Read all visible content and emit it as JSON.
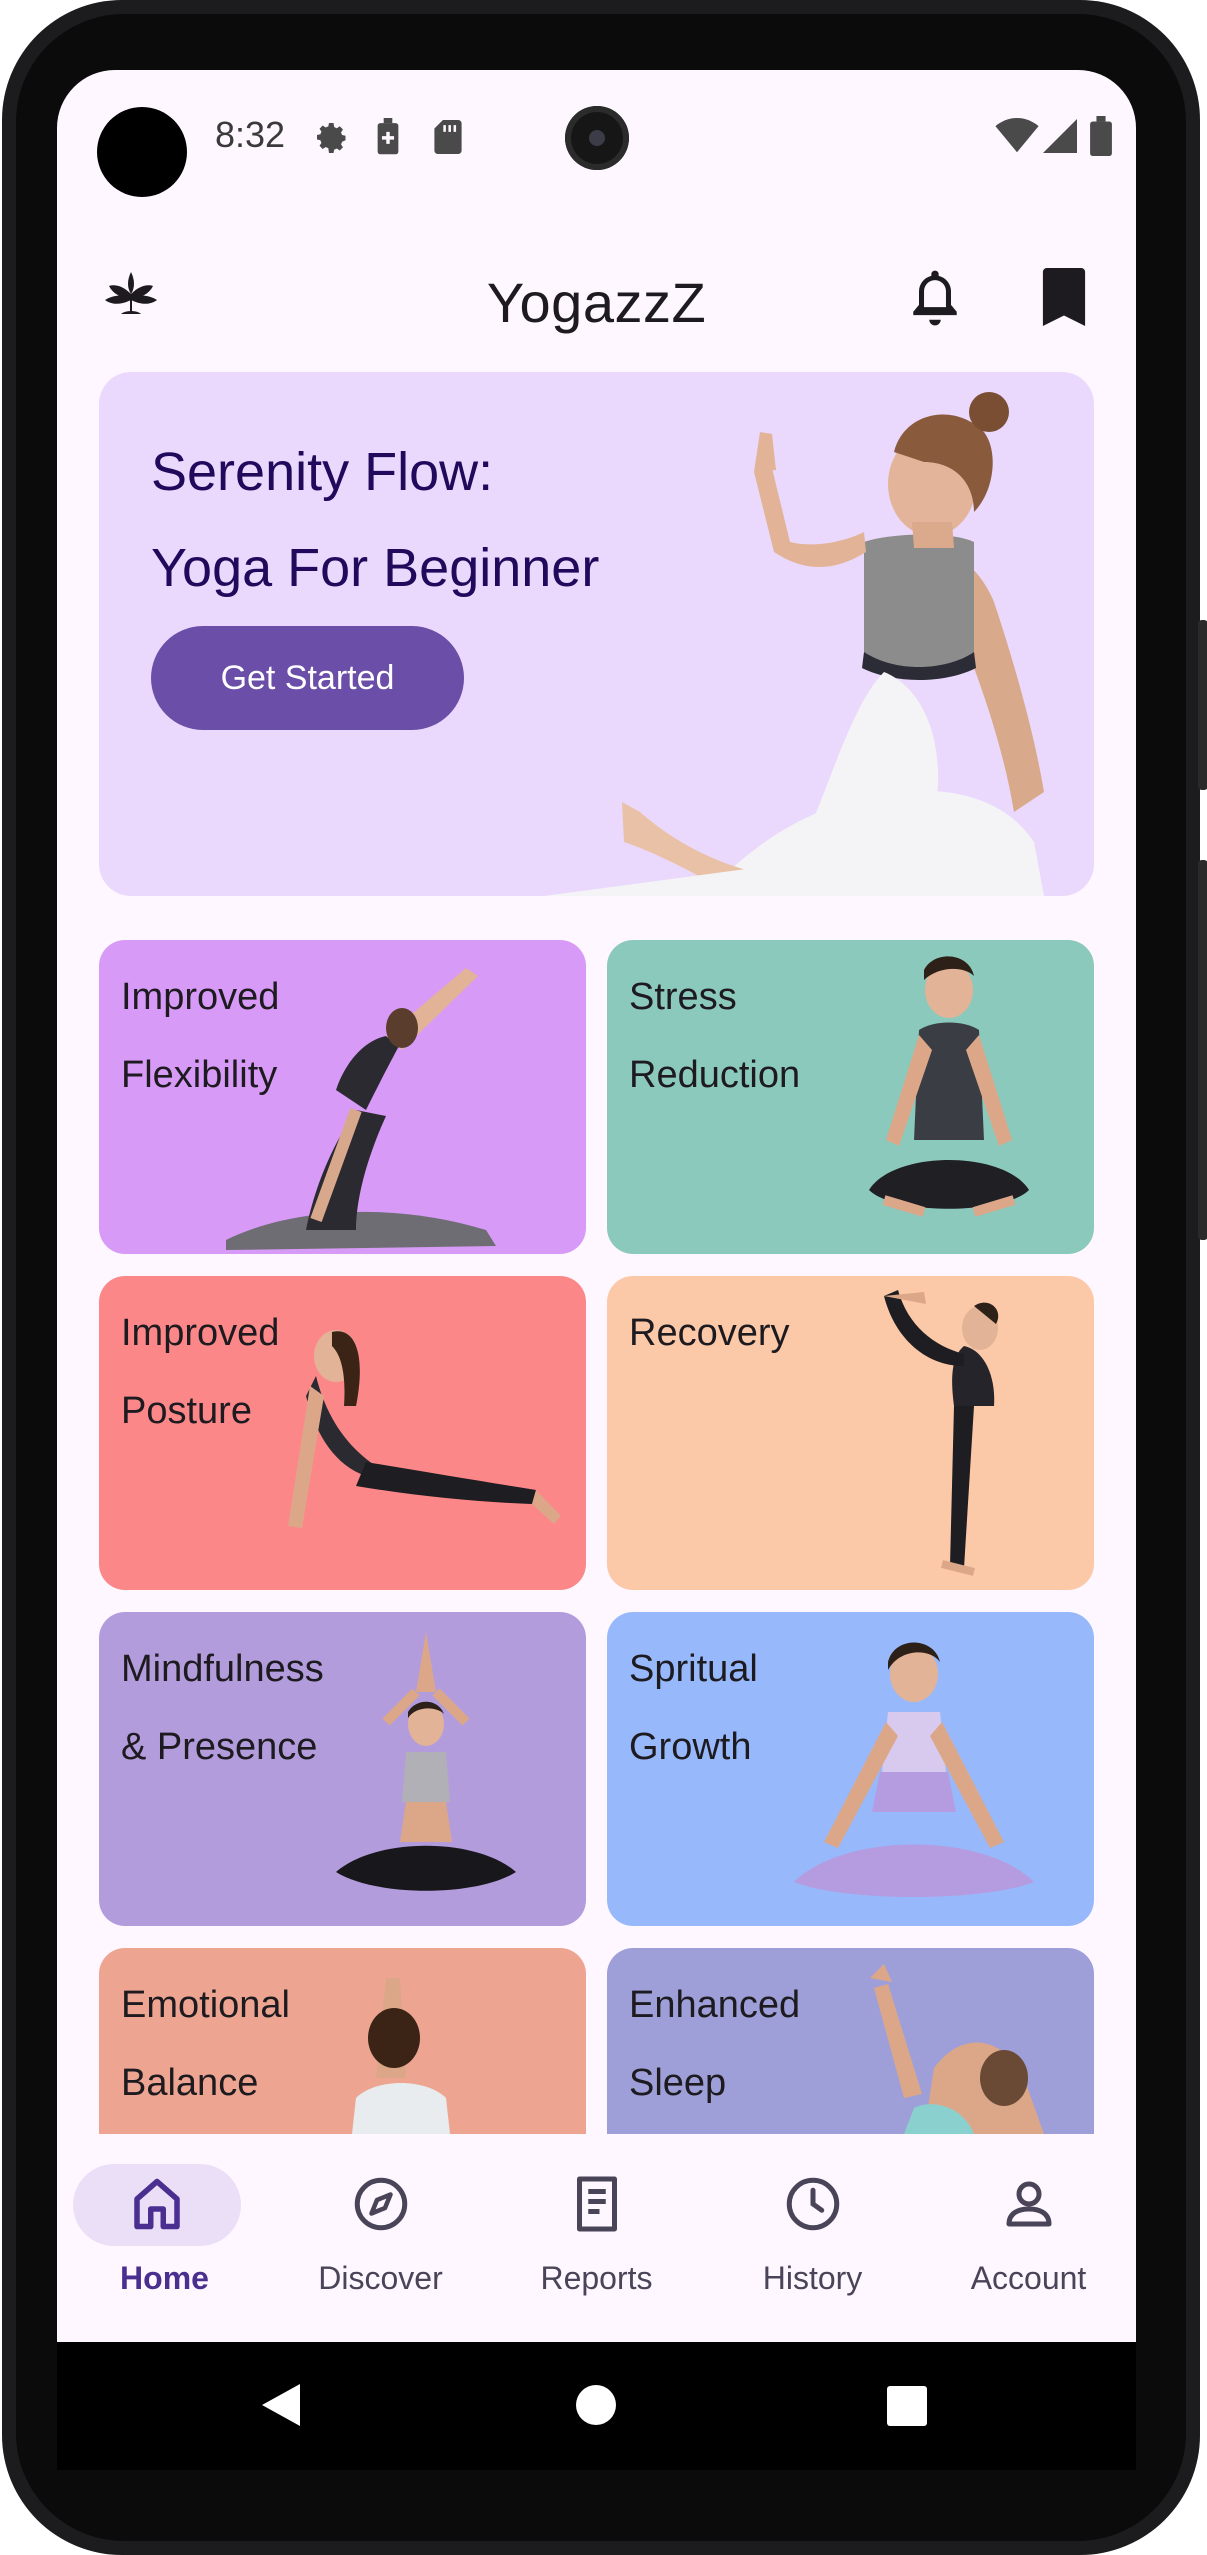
{
  "status_bar": {
    "time": "8:32",
    "left_icons": [
      "gear-icon",
      "battery-saver-icon",
      "sd-card-icon"
    ],
    "right_icons": [
      "wifi-icon",
      "signal-icon",
      "battery-icon"
    ]
  },
  "app_bar": {
    "title": "YogazzZ",
    "left_icon": "lotus-logo-icon",
    "right_icons": [
      "bell-icon",
      "bookmark-icon"
    ]
  },
  "hero": {
    "title_line1": "Serenity Flow:",
    "title_line2": "Yoga For Beginner",
    "button_label": "Get Started",
    "background": "#ead9fc",
    "button_color": "#6a4ea8"
  },
  "cards": [
    {
      "line1": "Improved",
      "line2": "Flexibility",
      "color": "#d89af7"
    },
    {
      "line1": "Stress",
      "line2": "Reduction",
      "color": "#8cc9bd"
    },
    {
      "line1": "Improved",
      "line2": "Posture",
      "color": "#fc8788"
    },
    {
      "line1": "Recovery",
      "line2": "",
      "color": "#fbc8a8"
    },
    {
      "line1": "Mindfulness",
      "line2": "& Presence",
      "color": "#b39cdc"
    },
    {
      "line1": "Spritual",
      "line2": "Growth",
      "color": "#97b9fb"
    },
    {
      "line1": "Emotional",
      "line2": "Balance",
      "color": "#eda592"
    },
    {
      "line1": "Enhanced",
      "line2": "Sleep",
      "color": "#9e9fd8"
    }
  ],
  "bottom_nav": {
    "items": [
      {
        "label": "Home",
        "icon": "home-icon",
        "active": true
      },
      {
        "label": "Discover",
        "icon": "compass-icon",
        "active": false
      },
      {
        "label": "Reports",
        "icon": "report-icon",
        "active": false
      },
      {
        "label": "History",
        "icon": "clock-icon",
        "active": false
      },
      {
        "label": "Account",
        "icon": "person-icon",
        "active": false
      }
    ]
  },
  "system_nav": [
    "back-icon",
    "home-circle-icon",
    "recents-icon"
  ]
}
